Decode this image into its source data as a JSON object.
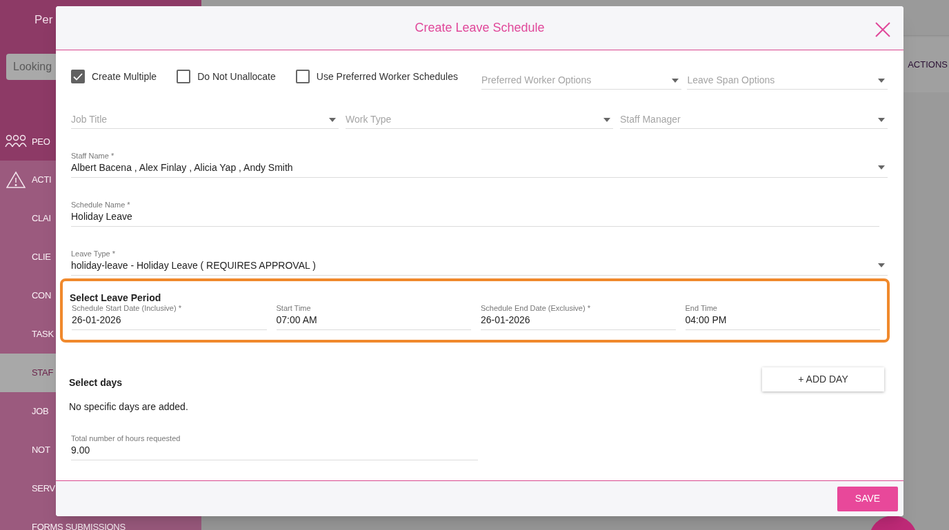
{
  "background": {
    "app_title": "Per",
    "search_placeholder": "Looking",
    "nav": [
      {
        "label": "PEO",
        "kind": "section",
        "selected": false
      },
      {
        "label": "ACTI",
        "kind": "section",
        "selected": false
      },
      {
        "label": "CLAI",
        "kind": "link",
        "selected": false
      },
      {
        "label": "CLIE",
        "kind": "link",
        "selected": false
      },
      {
        "label": "CON",
        "kind": "link",
        "selected": false
      },
      {
        "label": "TASK",
        "kind": "link",
        "selected": false
      },
      {
        "label": "STAF",
        "kind": "link",
        "selected": true
      },
      {
        "label": "JOB",
        "kind": "link",
        "selected": false
      },
      {
        "label": "NOT",
        "kind": "link",
        "selected": false
      },
      {
        "label": "SERV",
        "kind": "link",
        "selected": false
      },
      {
        "label": "FORMS SUBMISSIONS",
        "kind": "link",
        "selected": false
      }
    ],
    "table_header": "ACTIONS"
  },
  "dialog": {
    "title": "Create Leave Schedule",
    "options": [
      {
        "label": "Create Multiple",
        "checked": true
      },
      {
        "label": "Do Not Unallocate",
        "checked": false
      },
      {
        "label": "Use Preferred Worker Schedules",
        "checked": false
      }
    ],
    "option_selects": [
      {
        "placeholder": "Preferred Worker Options"
      },
      {
        "placeholder": "Leave Span Options"
      }
    ],
    "filters": [
      {
        "placeholder": "Job Title"
      },
      {
        "placeholder": "Work Type"
      },
      {
        "placeholder": "Staff Manager"
      }
    ],
    "fields": [
      {
        "label": "Staff Name *",
        "value": "Albert Bacena , Alex Finlay , Alicia Yap , Andy Smith",
        "kind": "select"
      },
      {
        "label": "Schedule Name *",
        "value": "Holiday Leave",
        "kind": "text"
      },
      {
        "label": "Leave Type *",
        "value": "holiday-leave - Holiday Leave ( REQUIRES APPROVAL )",
        "kind": "select"
      }
    ],
    "leave_period": {
      "title": "Select Leave Period",
      "fields": [
        {
          "label": "Schedule Start Date (Inclusive) *",
          "value": "26-01-2026"
        },
        {
          "label": "Start Time",
          "value": "07:00 AM"
        },
        {
          "label": "Schedule End Date (Exclusive) *",
          "value": "26-01-2026"
        },
        {
          "label": "End Time",
          "value": "04:00 PM"
        }
      ]
    },
    "select_days": {
      "title": "Select days",
      "empty_text": "No specific days are added.",
      "add_button": "+ ADD DAY"
    },
    "total_hours": {
      "label": "Total number of hours requested",
      "value": "9.00"
    },
    "save_button": "SAVE"
  }
}
